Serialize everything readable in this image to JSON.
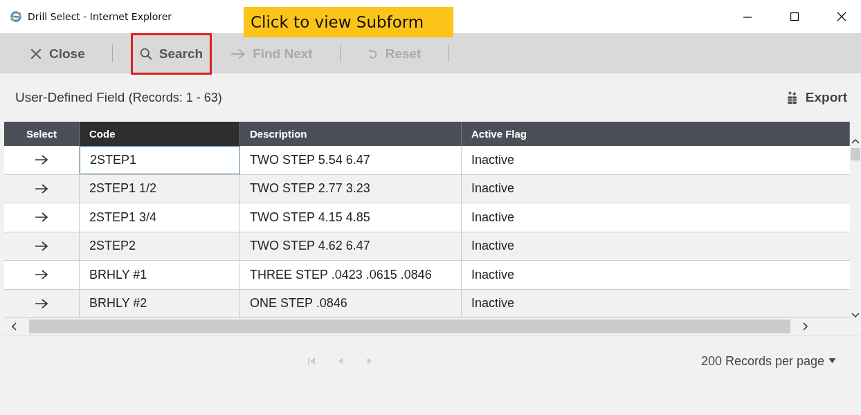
{
  "window": {
    "title": "Drill Select - Internet Explorer"
  },
  "callout": {
    "text": "Click to view Subform"
  },
  "toolbar": [
    {
      "label": "Close",
      "kind": "close",
      "disabled": false,
      "highlighted": false
    },
    {
      "label": "Search",
      "kind": "search",
      "disabled": false,
      "highlighted": true
    },
    {
      "label": "Find Next",
      "kind": "next",
      "disabled": true,
      "highlighted": false
    },
    {
      "label": "Reset",
      "kind": "reset",
      "disabled": true,
      "highlighted": false
    }
  ],
  "panel": {
    "title": "User-Defined Field",
    "records": "(Records: 1 - 63)",
    "export": "Export"
  },
  "table": {
    "columns": [
      {
        "label": "Select",
        "active": false
      },
      {
        "label": "Code",
        "active": true
      },
      {
        "label": "Description",
        "active": false
      },
      {
        "label": "Active Flag",
        "active": false
      }
    ],
    "rows": [
      {
        "code": "2STEP1",
        "description": "TWO STEP 5.54 6.47",
        "active_flag": "Inactive",
        "focused": true
      },
      {
        "code": "2STEP1 1/2",
        "description": "TWO STEP 2.77 3.23",
        "active_flag": "Inactive",
        "focused": false
      },
      {
        "code": "2STEP1 3/4",
        "description": "TWO STEP 4.15 4.85",
        "active_flag": "Inactive",
        "focused": false
      },
      {
        "code": "2STEP2",
        "description": "TWO STEP 4.62 6.47",
        "active_flag": "Inactive",
        "focused": false
      },
      {
        "code": "BRHLY #1",
        "description": "THREE STEP .0423 .0615 .0846",
        "active_flag": "Inactive",
        "focused": false
      },
      {
        "code": "BRHLY #2",
        "description": "ONE STEP .0846",
        "active_flag": "Inactive",
        "focused": false
      }
    ]
  },
  "pager": {
    "page_size": "200 Records per page"
  }
}
